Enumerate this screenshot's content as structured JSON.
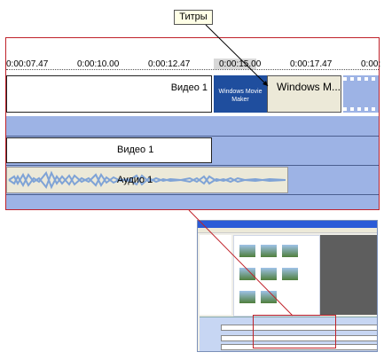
{
  "callout": {
    "label": "Титры"
  },
  "ruler": {
    "ticks": [
      "0:00:07.47",
      "0:00:10.00",
      "0:00:12.47",
      "0:00:15.00",
      "0:00:17.47",
      "0:00:"
    ]
  },
  "video_track": {
    "clip1_label": "Видео 1",
    "title_clip_label": "Windows M...",
    "thumb_text": "Windows Movie Maker"
  },
  "transition_track": {},
  "overlay_track": {
    "clip_label": "Видео 1"
  },
  "audio_track": {
    "clip_label": "Аудио 1"
  },
  "colors": {
    "frame_red": "#c0222a",
    "track_blue": "#9db3e5",
    "wmm_blue": "#1f4e9e"
  }
}
